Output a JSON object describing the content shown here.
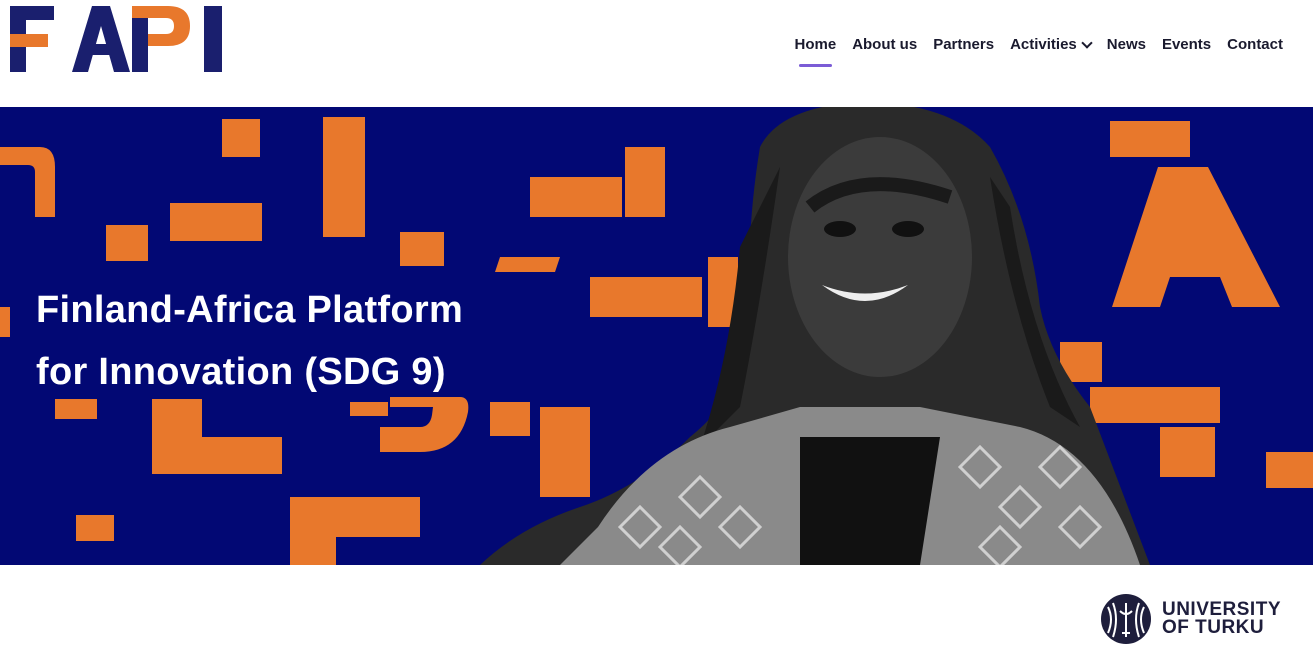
{
  "brand": {
    "logo_text": "FAPI",
    "colors": {
      "navy": "#1a1f6e",
      "orange": "#e8782c",
      "hero_bg": "#020874",
      "nav_accent": "#7b5cd6"
    }
  },
  "nav": {
    "items": [
      {
        "label": "Home",
        "active": true
      },
      {
        "label": "About us"
      },
      {
        "label": "Partners"
      },
      {
        "label": "Activities",
        "has_dropdown": true
      },
      {
        "label": "News"
      },
      {
        "label": "Events"
      },
      {
        "label": "Contact"
      }
    ]
  },
  "hero": {
    "title_line1": "Finland-Africa Platform",
    "title_line2": "for Innovation (SDG 9)"
  },
  "footer": {
    "university_line1": "UNIVERSITY",
    "university_line2": "OF TURKU"
  }
}
